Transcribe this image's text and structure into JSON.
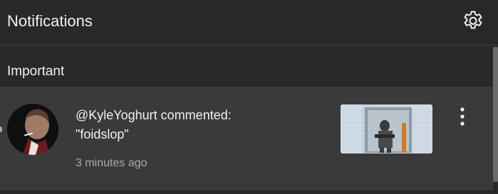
{
  "header": {
    "title": "Notifications",
    "settings_icon": "gear-icon"
  },
  "sections": [
    {
      "heading": "Important",
      "notifications": [
        {
          "text_line1": "@KyleYoghurt commented:",
          "text_line2": "\"foidslop\"",
          "time": "3 minutes ago",
          "avatar_icon": "user-avatar",
          "thumbnail_icon": "video-thumbnail",
          "menu_icon": "more-vertical-icon",
          "unread": true
        }
      ]
    }
  ],
  "colors": {
    "background": "#282828",
    "item_background": "#3a3a3a",
    "text_primary": "#f1f1f1",
    "text_secondary": "#aaaaaa"
  }
}
